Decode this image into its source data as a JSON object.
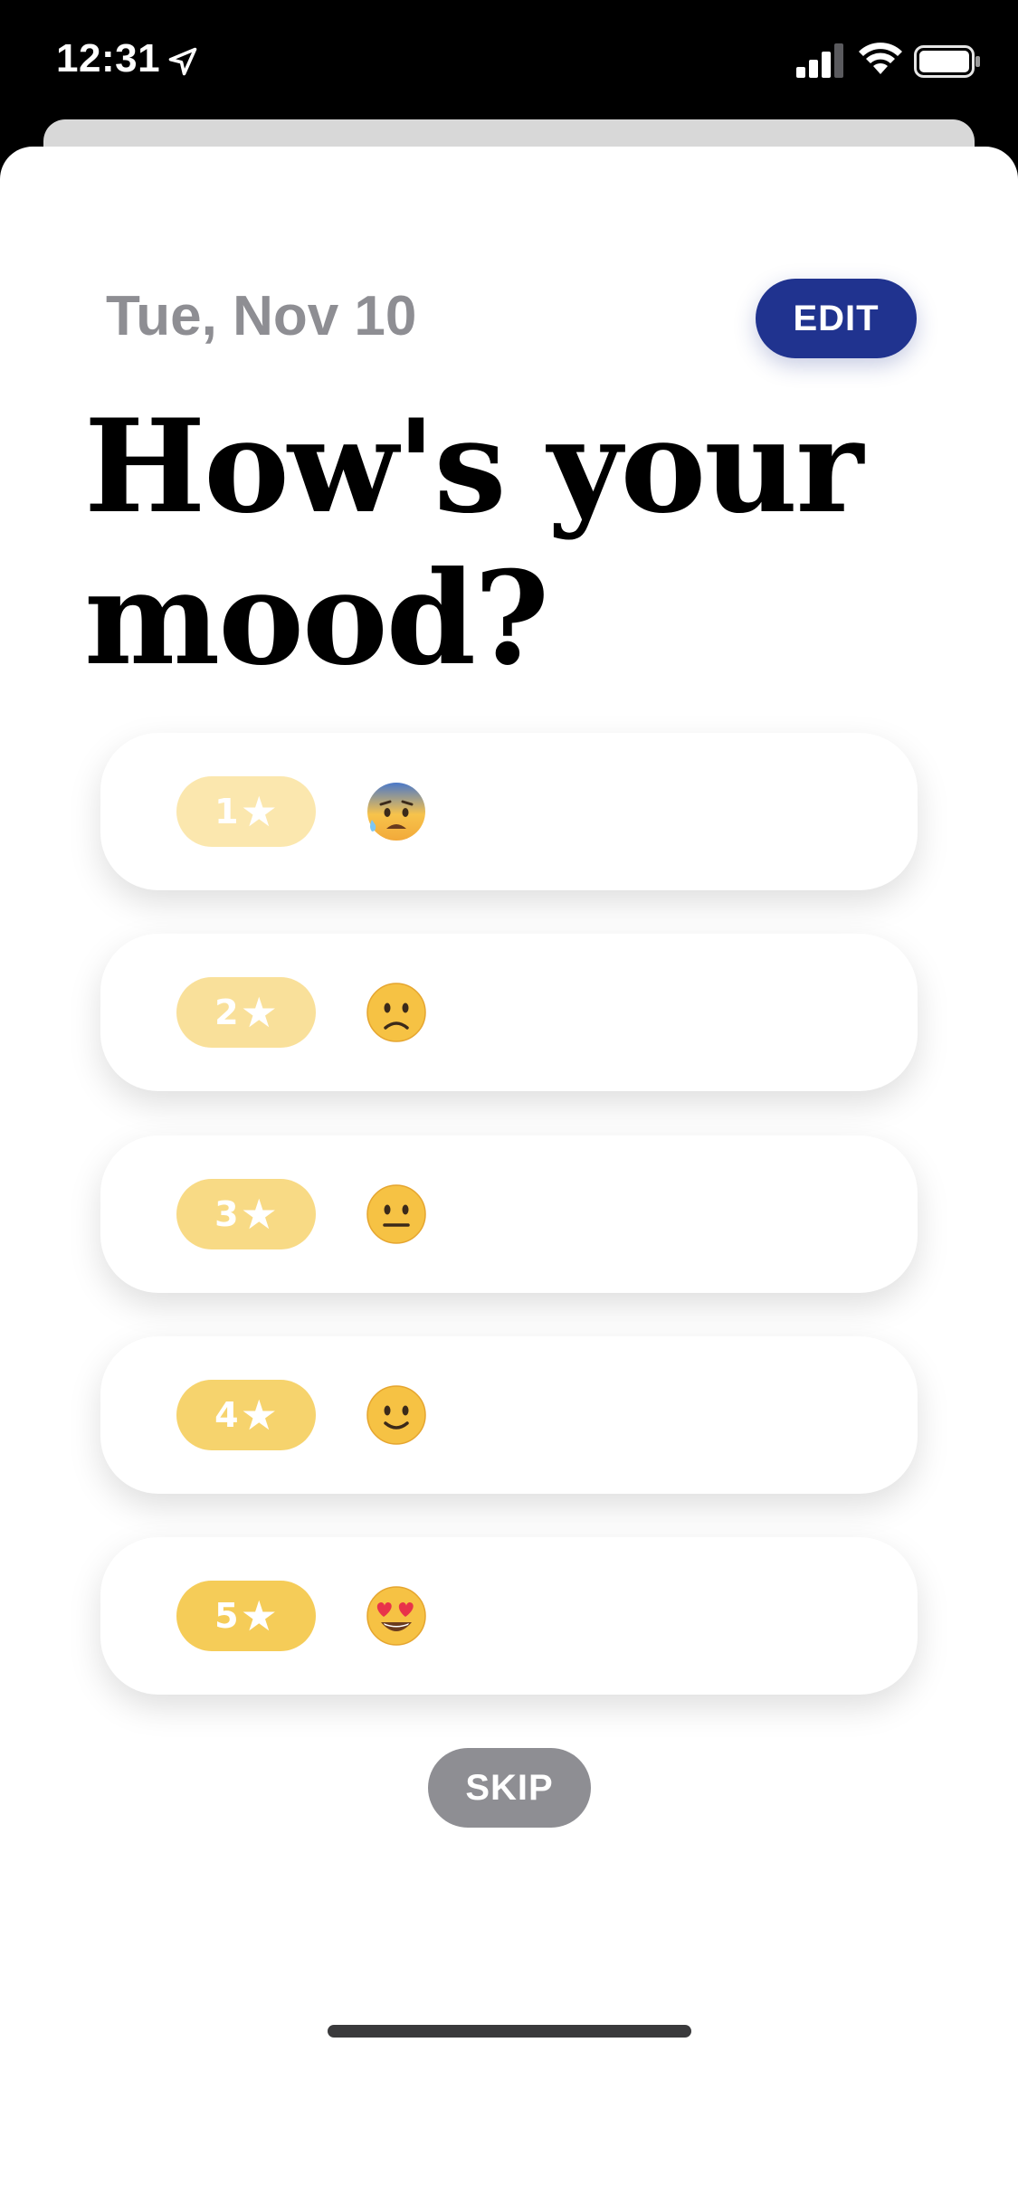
{
  "status_bar": {
    "time": "12:31",
    "location_icon": "location-arrow-icon",
    "signal_icon": "cellular-signal-icon",
    "wifi_icon": "wifi-icon",
    "battery_icon": "battery-icon"
  },
  "header": {
    "date": "Tue, Nov 10",
    "edit_label": "EDIT"
  },
  "title": "How's your mood?",
  "moods": [
    {
      "rating": "1",
      "star": "★",
      "emoji": "anxious-sweat-face-icon",
      "pill_color": "#fbe7ae"
    },
    {
      "rating": "2",
      "star": "★",
      "emoji": "slightly-frowning-face-icon",
      "pill_color": "#f9e09a"
    },
    {
      "rating": "3",
      "star": "★",
      "emoji": "neutral-face-icon",
      "pill_color": "#f8da85"
    },
    {
      "rating": "4",
      "star": "★",
      "emoji": "slightly-smiling-face-icon",
      "pill_color": "#f6d36d"
    },
    {
      "rating": "5",
      "star": "★",
      "emoji": "heart-eyes-face-icon",
      "pill_color": "#f5cc58"
    }
  ],
  "skip_label": "SKIP",
  "colors": {
    "edit_button": "#20338f",
    "skip_button": "#8e8e93",
    "date_text": "#8e8e93"
  }
}
